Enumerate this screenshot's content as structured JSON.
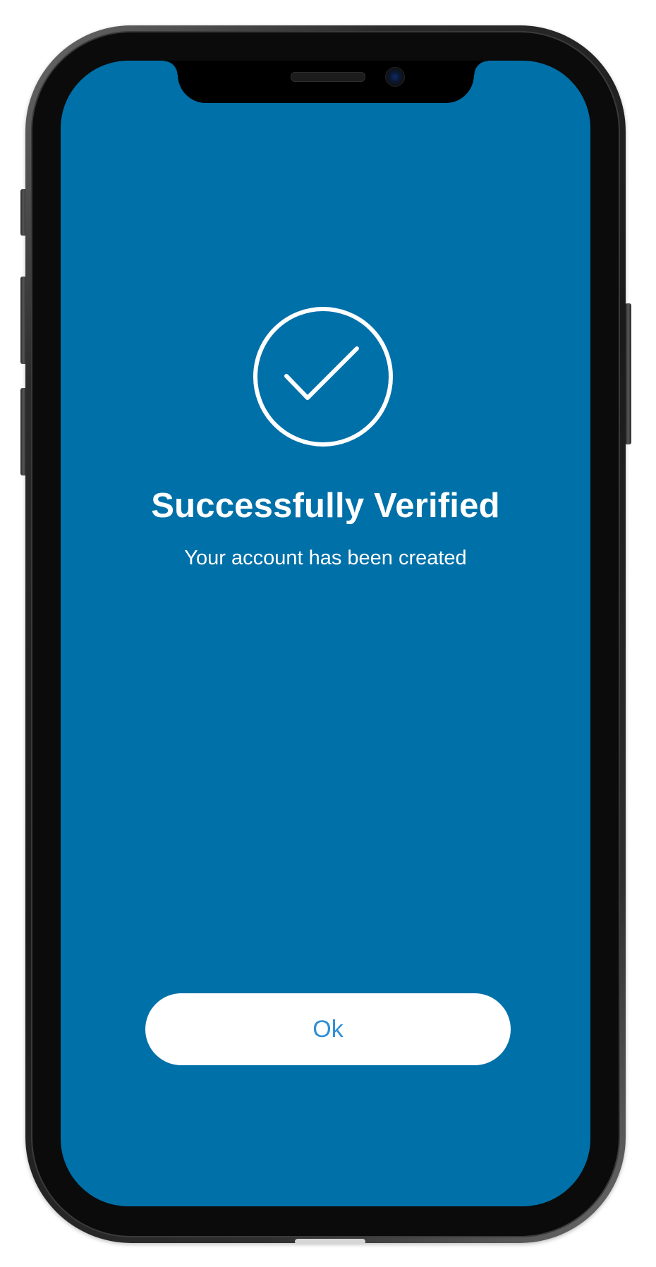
{
  "screen": {
    "background_color": "#0070a8",
    "status_icon": "check-circle-icon",
    "title": "Successfully Verified",
    "subtitle": "Your account has been created",
    "ok_button_label": "Ok",
    "ok_button_text_color": "#2f8fd6"
  },
  "device": {
    "model_shape": "notched-phone-frame"
  }
}
